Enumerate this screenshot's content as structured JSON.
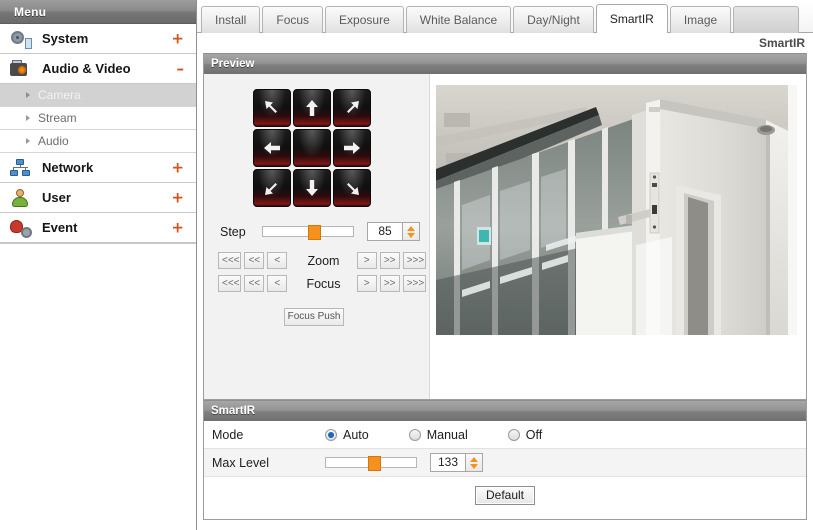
{
  "sidebar": {
    "header": "Menu",
    "items": [
      {
        "label": "System",
        "icon": "system-gear-icon",
        "toggle": "+"
      },
      {
        "label": "Audio & Video",
        "icon": "camera-icon",
        "toggle": "–"
      },
      {
        "label": "Network",
        "icon": "network-icon",
        "toggle": "+"
      },
      {
        "label": "User",
        "icon": "user-icon",
        "toggle": "+"
      },
      {
        "label": "Event",
        "icon": "event-bell-icon",
        "toggle": "+"
      }
    ],
    "subitems": [
      {
        "label": "Camera",
        "active": true
      },
      {
        "label": "Stream",
        "active": false
      },
      {
        "label": "Audio",
        "active": false
      }
    ]
  },
  "tabs": [
    {
      "label": "Install",
      "active": false
    },
    {
      "label": "Focus",
      "active": false
    },
    {
      "label": "Exposure",
      "active": false
    },
    {
      "label": "White Balance",
      "active": false
    },
    {
      "label": "Day/Night",
      "active": false
    },
    {
      "label": "SmartIR",
      "active": true
    },
    {
      "label": "Image",
      "active": false
    }
  ],
  "breadcrumb": "SmartIR",
  "preview": {
    "section_title": "Preview",
    "ptz": {
      "directions": [
        "up-left",
        "up",
        "up-right",
        "left",
        "center",
        "right",
        "down-left",
        "down",
        "down-right"
      ],
      "step_label": "Step",
      "step_value": "85",
      "step_percent": 58
    },
    "zoom": {
      "label": "Zoom",
      "left_buttons": [
        "<<<",
        "<<",
        "<"
      ],
      "right_buttons": [
        ">",
        ">>",
        ">>>"
      ]
    },
    "focus": {
      "label": "Focus",
      "left_buttons": [
        "<<<",
        "<<",
        "<"
      ],
      "right_buttons": [
        ">",
        ">>",
        ">>>"
      ]
    },
    "focus_push_label": "Focus Push"
  },
  "smartir": {
    "section_title": "SmartIR",
    "mode_label": "Mode",
    "mode_options": [
      {
        "label": "Auto",
        "selected": true
      },
      {
        "label": "Manual",
        "selected": false
      },
      {
        "label": "Off",
        "selected": false
      }
    ],
    "max_level_label": "Max Level",
    "max_level_value": "133",
    "max_level_percent": 55,
    "default_button": "Default"
  },
  "colors": {
    "accent_orange": "#f5921e",
    "radio_blue": "#1767c4",
    "toggle_orange": "#d2531c",
    "section_bar": "#8a8a8a"
  }
}
